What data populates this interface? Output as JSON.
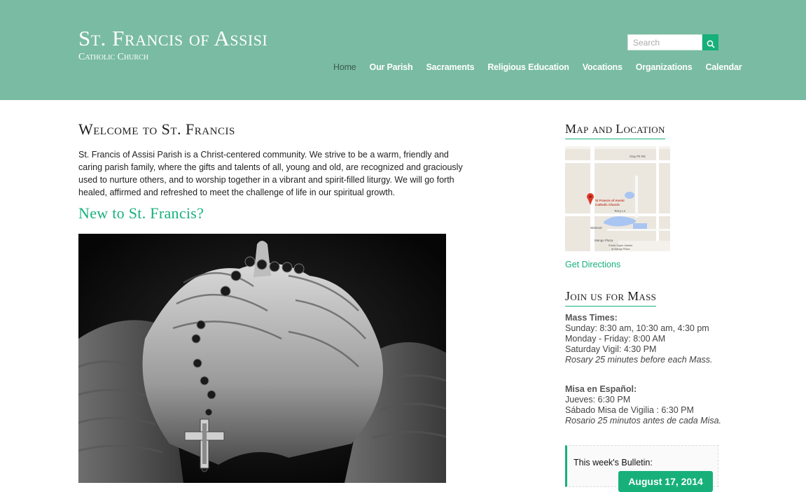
{
  "site": {
    "title": "St. Francis of Assisi",
    "subtitle": "Catholic Church"
  },
  "search": {
    "placeholder": "Search",
    "button_icon": "search-icon"
  },
  "nav": {
    "items": [
      {
        "label": "Home",
        "active": true
      },
      {
        "label": "Our Parish"
      },
      {
        "label": "Sacraments"
      },
      {
        "label": "Religious Education"
      },
      {
        "label": "Vocations"
      },
      {
        "label": "Organizations"
      },
      {
        "label": "Calendar"
      }
    ]
  },
  "main": {
    "welcome_title": "Welcome to St. Francis",
    "intro": "St. Francis of Assisi Parish is a Christ-centered community. We strive to be a warm, friendly and caring parish family, where the gifts and talents of all, young and old, are recognized and graciously used to nurture others, and to worship together in a vibrant and spirit-filled liturgy. We will go forth healed, affirmed and refreshed to meet the challenge of life in our spiritual growth.",
    "new_title": "New to St. Francis?"
  },
  "sidebar": {
    "map_title": "Map and Location",
    "map": {
      "labels": {
        "pin_line1": "St Francis of Assisi",
        "pin_line2": "Catholic Church",
        "clay_pit": "Clay Pit Rd",
        "terry": "Terry Ln",
        "walmart": "Walmart",
        "mango": "Mango Plaza",
        "publix1": "Publix Super Market",
        "publix2": "at Mango Plaza"
      }
    },
    "directions": "Get Directions",
    "mass_title": "Join us for Mass",
    "mass_english": {
      "heading": "Mass Times:",
      "line1": "Sunday: 8:30 am, 10:30 am, 4:30 pm",
      "line2": "Monday - Friday: 8:00 AM",
      "line3": "Saturday Vigil: 4:30 PM",
      "note": "Rosary 25 minutes before each Mass."
    },
    "mass_spanish": {
      "heading": "Misa en Español:",
      "line1": "Jueves: 6:30 PM",
      "line2": "Sábado Misa de Vigilia : 6:30 PM",
      "note": "Rosario 25 minutos antes de cada Misa."
    },
    "bulletin": {
      "label": "This week's Bulletin:",
      "button": "August 17, 2014"
    }
  },
  "colors": {
    "header": "#79bba3",
    "accent": "#17b07b",
    "white": "#ffffff"
  }
}
